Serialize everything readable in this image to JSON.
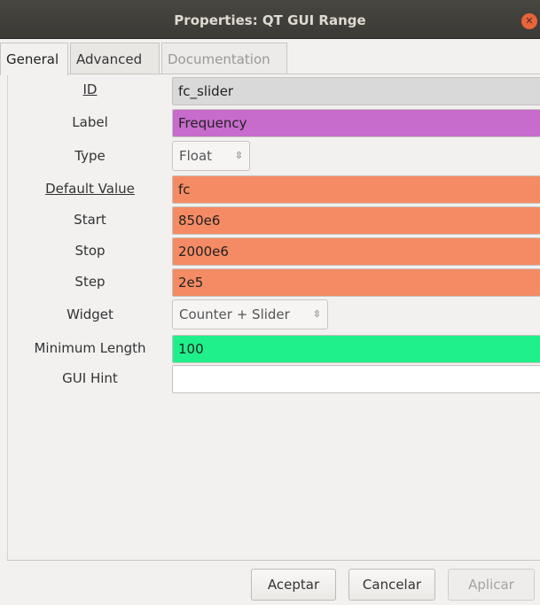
{
  "window": {
    "title": "Properties: QT GUI Range",
    "close_icon": "close-icon"
  },
  "tabs": [
    {
      "label": "General",
      "state": "active"
    },
    {
      "label": "Advanced",
      "state": "normal"
    },
    {
      "label": "Documentation",
      "state": "disabled"
    }
  ],
  "fields": {
    "id": {
      "label": "ID",
      "value": "fc_slider",
      "color": "#d9d9d9"
    },
    "label": {
      "label": "Label",
      "value": "Frequency",
      "color": "#c76bcd"
    },
    "type": {
      "label": "Type",
      "value": "Float"
    },
    "default_value": {
      "label": "Default Value",
      "value": "fc",
      "color": "#f58b64"
    },
    "start": {
      "label": "Start",
      "value": "850e6",
      "color": "#f58b64"
    },
    "stop": {
      "label": "Stop",
      "value": "2000e6",
      "color": "#f58b64"
    },
    "step": {
      "label": "Step",
      "value": "2e5",
      "color": "#f58b64"
    },
    "widget": {
      "label": "Widget",
      "value": "Counter + Slider"
    },
    "minimum_length": {
      "label": "Minimum Length",
      "value": "100",
      "color": "#1ff08c"
    },
    "gui_hint": {
      "label": "GUI Hint",
      "value": "",
      "color": "#ffffff"
    }
  },
  "buttons": {
    "accept": "Aceptar",
    "cancel": "Cancelar",
    "apply": "Aplicar"
  }
}
